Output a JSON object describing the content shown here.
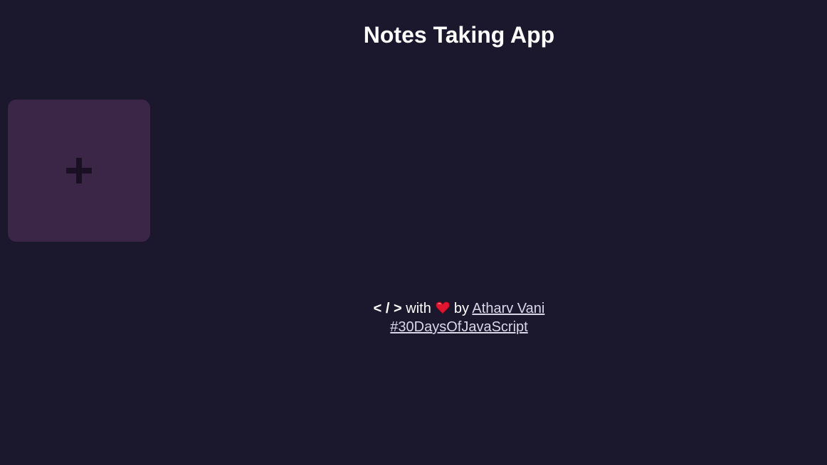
{
  "header": {
    "title": "Notes Taking App"
  },
  "notes": {
    "add_button_icon": "plus-icon"
  },
  "footer": {
    "code_tag": "< / >",
    "with_text": "with",
    "heart_icon": "heart-icon",
    "by_text": "by",
    "author_link": "Atharv Vani",
    "hashtag_link": "#30DaysOfJavaScript"
  },
  "colors": {
    "background": "#1b182d",
    "add_card": "#3b2647",
    "plus": "#1a1023",
    "heart": "#e0152f"
  }
}
